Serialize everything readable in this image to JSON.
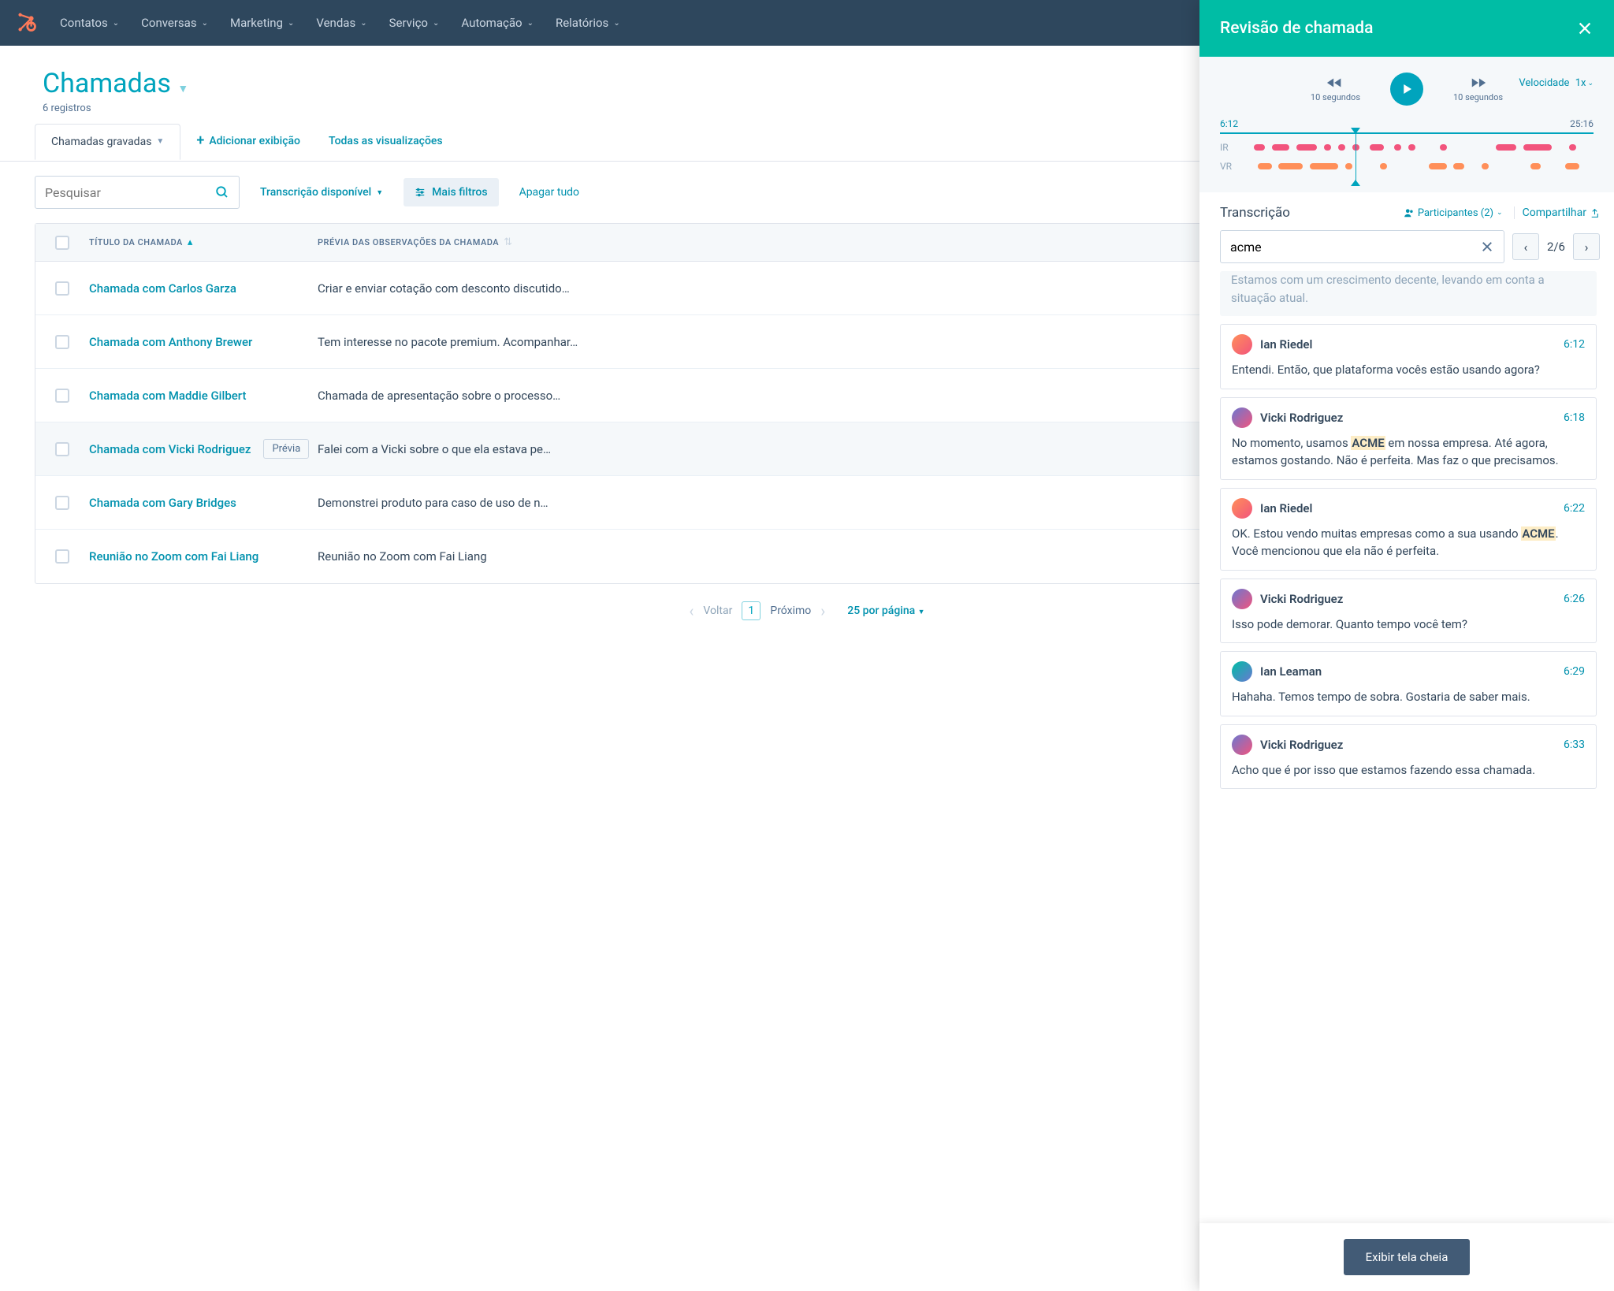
{
  "nav": {
    "items": [
      {
        "label": "Contatos"
      },
      {
        "label": "Conversas"
      },
      {
        "label": "Marketing"
      },
      {
        "label": "Vendas"
      },
      {
        "label": "Serviço"
      },
      {
        "label": "Automação"
      },
      {
        "label": "Relatórios"
      }
    ]
  },
  "page": {
    "title": "Chamadas",
    "subtitle": "6 registros"
  },
  "tabs": {
    "active": "Chamadas gravadas",
    "add_view": "Adicionar exibição",
    "all_views": "Todas as visualizações"
  },
  "filters": {
    "search_placeholder": "Pesquisar",
    "transcription": "Transcrição disponível",
    "more": "Mais filtros",
    "clear": "Apagar tudo"
  },
  "table": {
    "col_title": "TÍTULO DA CHAMADA",
    "col_notes": "PRÉVIA DAS OBSERVAÇÕES DA CHAMADA",
    "rows": [
      {
        "title": "Chamada com Carlos Garza",
        "notes": "Criar e enviar cotação com desconto discutido…",
        "selected": false,
        "preview": false
      },
      {
        "title": "Chamada com Anthony Brewer",
        "notes": "Tem interesse no pacote premium. Acompanhar…",
        "selected": false,
        "preview": false
      },
      {
        "title": "Chamada com Maddie Gilbert",
        "notes": "Chamada de apresentação sobre o processo…",
        "selected": false,
        "preview": false
      },
      {
        "title": "Chamada com Vicki Rodriguez",
        "notes": "Falei com a Vicki sobre o que ela estava pe…",
        "selected": true,
        "preview": true
      },
      {
        "title": "Chamada com Gary Bridges",
        "notes": "Demonstrei produto para caso de uso de n…",
        "selected": false,
        "preview": false
      },
      {
        "title": "Reunião no Zoom com Fai Liang",
        "notes": "Reunião no Zoom com Fai Liang",
        "selected": false,
        "preview": false
      }
    ],
    "preview_label": "Prévia"
  },
  "pagination": {
    "back": "Voltar",
    "page": "1",
    "next": "Próximo",
    "per_page": "25 por página"
  },
  "panel": {
    "title": "Revisão de chamada",
    "speed_label": "Velocidade",
    "speed_value": "1x",
    "skip_label": "10 segundos",
    "time_start": "6:12",
    "time_end": "25:16",
    "track_a": "IR",
    "track_b": "VR",
    "transcript_title": "Transcrição",
    "participants_label": "Participantes (2)",
    "share": "Compartilhar",
    "search_value": "acme",
    "result_count": "2/6",
    "intro_text": "Estamos com um crescimento decente, levando em conta a situação atual.",
    "entries": [
      {
        "speaker": "Ian Riedel",
        "time": "6:12",
        "av": "av1",
        "text_pre": "Entendi. Então, que plataforma vocês estão usando agora?",
        "hl": "",
        "text_post": ""
      },
      {
        "speaker": "Vicki Rodriguez",
        "time": "6:18",
        "av": "av2",
        "text_pre": "No momento, usamos ",
        "hl": "ACME",
        "text_post": " em nossa empresa. Até agora, estamos gostando. Não é perfeita. Mas faz o que precisamos."
      },
      {
        "speaker": "Ian Riedel",
        "time": "6:22",
        "av": "av1",
        "text_pre": "OK. Estou vendo muitas empresas como a sua usando ",
        "hl": "ACME",
        "text_post": ". Você mencionou que ela não é perfeita."
      },
      {
        "speaker": "Vicki Rodriguez",
        "time": "6:26",
        "av": "av2",
        "text_pre": "Isso pode demorar. Quanto tempo você tem?",
        "hl": "",
        "text_post": ""
      },
      {
        "speaker": "Ian Leaman",
        "time": "6:29",
        "av": "av3",
        "text_pre": "Hahaha. Temos tempo de sobra. Gostaria de saber mais.",
        "hl": "",
        "text_post": ""
      },
      {
        "speaker": "Vicki Rodriguez",
        "time": "6:33",
        "av": "av2",
        "text_pre": "Acho que é por isso que estamos fazendo essa chamada.",
        "hl": "",
        "text_post": ""
      }
    ],
    "fullscreen": "Exibir tela cheia"
  },
  "segments_pink": [
    {
      "l": 3,
      "w": 3
    },
    {
      "l": 8,
      "w": 5
    },
    {
      "l": 15,
      "w": 6
    },
    {
      "l": 23,
      "w": 2
    },
    {
      "l": 27,
      "w": 2
    },
    {
      "l": 31,
      "w": 2
    },
    {
      "l": 36,
      "w": 4
    },
    {
      "l": 43,
      "w": 2
    },
    {
      "l": 47,
      "w": 2
    },
    {
      "l": 56,
      "w": 2
    },
    {
      "l": 72,
      "w": 6
    },
    {
      "l": 80,
      "w": 8
    },
    {
      "l": 93,
      "w": 2
    }
  ],
  "segments_orange": [
    {
      "l": 4,
      "w": 4
    },
    {
      "l": 10,
      "w": 7
    },
    {
      "l": 19,
      "w": 8
    },
    {
      "l": 29,
      "w": 2
    },
    {
      "l": 39,
      "w": 2
    },
    {
      "l": 53,
      "w": 5
    },
    {
      "l": 60,
      "w": 3
    },
    {
      "l": 68,
      "w": 2
    },
    {
      "l": 82,
      "w": 3
    },
    {
      "l": 92,
      "w": 4
    }
  ]
}
